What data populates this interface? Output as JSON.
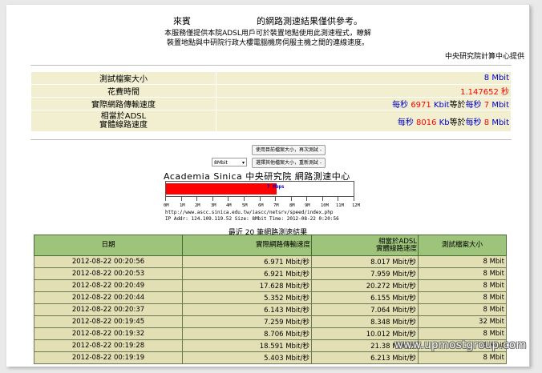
{
  "header": {
    "line1_prefix": "來賓",
    "line1_suffix": "的網路測速結果僅供參考。",
    "line2": "本服務僅提供本院ADSL用戶可於裝置地點使用此測速程式，瞭解",
    "line3": "裝置地點與中研院行政大樓電腦機房伺服主機之間的連線速度。",
    "provider": "中央研究院計算中心提供"
  },
  "info": {
    "file_size_label": "測試檔案大小",
    "file_size_value": "8 Mbit",
    "time_label": "花費時間",
    "time_value": "1.147652",
    "time_unit": "秒",
    "speed_label": "實際網路傳輸速度",
    "speed_prefix": "每秒",
    "speed_kbit": "6971",
    "speed_kbit_unit": "Kbit",
    "speed_equals": "等於",
    "speed_prefix2": "每秒",
    "speed_mbit": "7",
    "speed_mbit_unit": "Mbit",
    "adsl_label_1": "相當於ADSL",
    "adsl_label_2": "實體線路速度",
    "adsl_prefix": "每秒",
    "adsl_kb": "8016",
    "adsl_kb_unit": "Kb",
    "adsl_equals": "等於",
    "adsl_prefix2": "每秒",
    "adsl_mbit": "8",
    "adsl_mbit_unit": "Mbit"
  },
  "controls": {
    "retest_label": "使用目前檔案大小，再次測試 -",
    "size_select_value": "8Mbit",
    "select_retest_label": "選擇其他檔案大小，重新測試 -"
  },
  "speed_graph": {
    "banner": "Academia Sinica 中央研究院 網路測速中心",
    "speed_label": "7 Mbps",
    "speed_mbps": 7,
    "max_mbps": 12,
    "tick_labels": [
      "0M",
      "1M",
      "2M",
      "3M",
      "4M",
      "5M",
      "6M",
      "7M",
      "8M",
      "9M",
      "10M",
      "11M",
      "12M"
    ],
    "url": "http://www.ascc.sinica.edu.tw/iascc/netsrv/speed/index.php",
    "ip_line": "IP Addr: 124.109.119.52 Size: 8Mbit Time: 2012-08-22 0:20:56"
  },
  "recent": {
    "title": "最近 20 筆網路測速結果",
    "headers": [
      "日期",
      "實際網路傳輸速度",
      "相當於ADSL\n實體線路速度",
      "測試檔案大小"
    ],
    "rows": [
      [
        "2012-08-22 00:20:56",
        "6.971 Mbit/秒",
        "8.017 Mbit/秒",
        "8 Mbit"
      ],
      [
        "2012-08-22 00:20:53",
        "6.921 Mbit/秒",
        "7.959 Mbit/秒",
        "8 Mbit"
      ],
      [
        "2012-08-22 00:20:49",
        "17.628 Mbit/秒",
        "20.272 Mbit/秒",
        "8 Mbit"
      ],
      [
        "2012-08-22 00:20:44",
        "5.352 Mbit/秒",
        "6.155 Mbit/秒",
        "8 Mbit"
      ],
      [
        "2012-08-22 00:20:37",
        "6.143 Mbit/秒",
        "7.064 Mbit/秒",
        "8 Mbit"
      ],
      [
        "2012-08-22 00:19:45",
        "7.259 Mbit/秒",
        "8.348 Mbit/秒",
        "32 Mbit"
      ],
      [
        "2012-08-22 00:19:32",
        "8.706 Mbit/秒",
        "10.012 Mbit/秒",
        "8 Mbit"
      ],
      [
        "2012-08-22 00:19:28",
        "18.591 Mbit/秒",
        "21.38 Mbit/秒",
        "8 Mbit"
      ],
      [
        "2012-08-22 00:19:19",
        "5.403 Mbit/秒",
        "6.213 Mbit/秒",
        "8 Mbit"
      ]
    ]
  },
  "watermark": "www.upmostgroup.com"
}
